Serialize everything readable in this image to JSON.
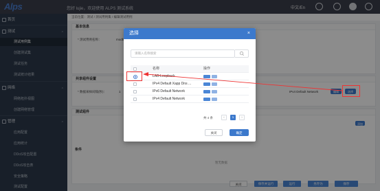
{
  "header": {
    "logo": "Alps",
    "welcome": "您好 lujie，欢迎使用 ALPS 测试系统",
    "lang": "中文/En"
  },
  "sidebar": {
    "items": [
      {
        "label": "首页",
        "icon": "home-icon",
        "kind": "top"
      },
      {
        "label": "测试",
        "icon": "play-icon",
        "kind": "top"
      },
      {
        "label": "测试用例集",
        "kind": "sub",
        "active": true
      },
      {
        "label": "创建测试集",
        "kind": "sub"
      },
      {
        "label": "测试任务",
        "kind": "sub"
      },
      {
        "label": "测试统计结果",
        "kind": "sub"
      },
      {
        "label": "网络",
        "icon": "network-icon",
        "kind": "top"
      },
      {
        "label": "网络拓扑视图",
        "kind": "sub"
      },
      {
        "label": "创建网络管理",
        "kind": "sub"
      },
      {
        "label": "管理",
        "icon": "gear-icon",
        "kind": "top"
      },
      {
        "label": "应用配置",
        "kind": "sub"
      },
      {
        "label": "应用统计",
        "kind": "sub"
      },
      {
        "label": "DDoS攻击配置",
        "kind": "sub"
      },
      {
        "label": "DDoS攻击表",
        "kind": "sub"
      },
      {
        "label": "安全策略",
        "kind": "sub"
      },
      {
        "label": "测试配置",
        "kind": "sub"
      }
    ]
  },
  "breadcrumb": "当前位置：测试 / 测试用例集 / 编辑测试用例",
  "main": {
    "basic_info_title": "基本信息",
    "test_name_label": "* 测试用例名称：",
    "test_name_value": "modbus",
    "shared_title": "共享组件设置",
    "shared_label": "* 数据采样间隔(秒)：",
    "shared_value": "1",
    "shared_network": "IPv4 Default Network",
    "shared_btn_edit": "编辑",
    "shared_btn_select": "选择",
    "test_components_title": "测试组件",
    "add_btn": "添加",
    "no_data": "暂无数据",
    "conditions_title": "条件",
    "bottom_buttons": [
      "关闭",
      "保存并运行",
      "运行",
      "另存为",
      "保存"
    ]
  },
  "modal": {
    "title": "选择",
    "close": "×",
    "search_placeholder": "请输入名称搜索",
    "columns": [
      "名称",
      "操作"
    ],
    "rows": [
      {
        "name": "LAB-Loopback",
        "selected": true,
        "op_edit": "编辑",
        "op_delete": "删除"
      },
      {
        "name": "IPv4 Default Xapp Dns ...",
        "selected": false,
        "op_edit": "编辑",
        "op_delete": "删除"
      },
      {
        "name": "IPv6 Default Network",
        "selected": false,
        "op_edit": "编辑",
        "op_delete": "删除"
      },
      {
        "name": "IPv4 Default Network",
        "selected": false,
        "op_edit": "编辑",
        "op_delete": "删除"
      }
    ],
    "pager": {
      "total": "共 4 条",
      "page": "1",
      "prev": "‹",
      "next": "›"
    },
    "cancel": "关闭",
    "ok": "确定"
  },
  "colors": {
    "accent": "#3c79cc",
    "sidebar": "#2d3a4b",
    "topbar": "#3b3f4c",
    "annotation": "#e33"
  }
}
